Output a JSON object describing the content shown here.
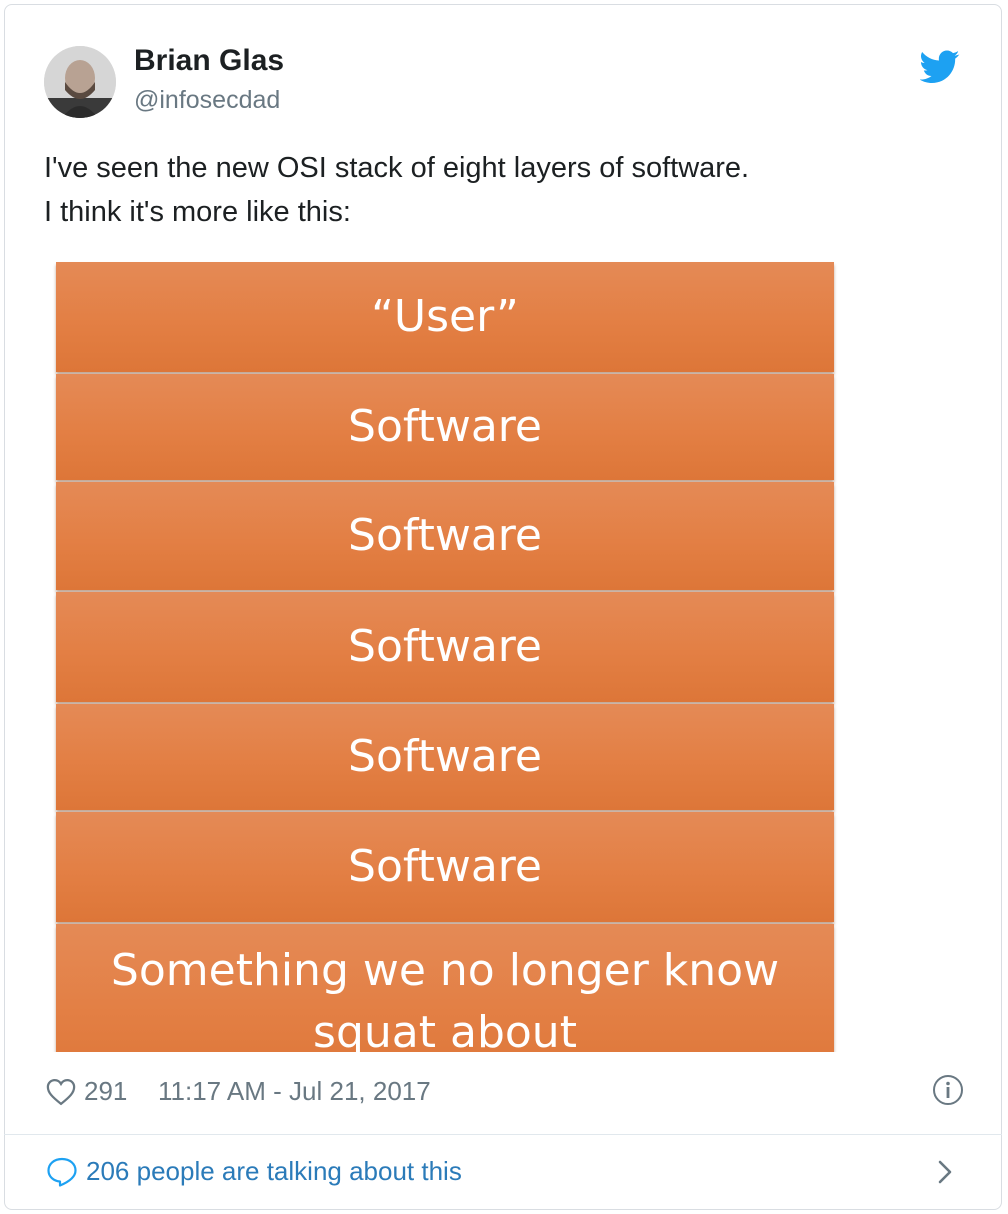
{
  "author": {
    "name": "Brian Glas",
    "handle": "@infosecdad"
  },
  "tweet": {
    "line1": "I've seen the new OSI stack of eight layers of software.",
    "line2": "I think it's more like this:"
  },
  "image": {
    "layers": [
      "“User”",
      "Software",
      "Software",
      "Software",
      "Software",
      "Software",
      "Something we no longer know squat about"
    ],
    "layer_color": "#e37f44"
  },
  "footer": {
    "likes": "291",
    "timestamp": "11:17 AM - Jul 21, 2017"
  },
  "conversation": {
    "label": "206 people are talking about this"
  },
  "colors": {
    "twitter_blue": "#1da1f2",
    "link_blue": "#2b7bb9",
    "meta_gray": "#697882"
  },
  "icons": {
    "brand": "twitter-bird-icon",
    "like": "heart-icon",
    "info": "info-icon",
    "reply": "speech-bubble-icon",
    "more": "chevron-right-icon"
  }
}
